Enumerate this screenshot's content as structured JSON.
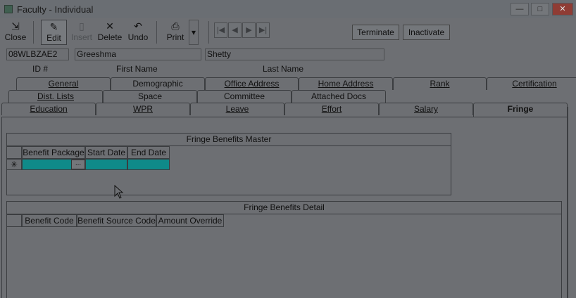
{
  "window": {
    "title": "Faculty - Individual",
    "minimize_symbol": "—",
    "maximize_symbol": "□",
    "close_symbol": "✕"
  },
  "toolbar": {
    "close": "Close",
    "edit": "Edit",
    "insert": "Insert",
    "delete": "Delete",
    "undo": "Undo",
    "print": "Print",
    "print_dropdown": "▾",
    "nav_first": "|◀",
    "nav_prev": "◀",
    "nav_next": "▶",
    "nav_last": "▶|",
    "terminate": "Terminate",
    "inactivate": "Inactivate"
  },
  "record": {
    "id_value": "08WLBZAE2",
    "first_name_value": "Greeshma",
    "last_name_value": "Shetty",
    "id_label": "ID #",
    "first_name_label": "First Name",
    "last_name_label": "Last Name"
  },
  "tabs": {
    "row1": [
      "General",
      "Demographic",
      "Office Address",
      "Home Address",
      "Rank",
      "Certification"
    ],
    "row2": [
      "Dist. Lists",
      "Space",
      "Committee",
      "Attached Docs"
    ],
    "row3": [
      "Education",
      "WPR",
      "Leave",
      "Effort",
      "Salary",
      "Fringe"
    ]
  },
  "master": {
    "title": "Fringe Benefits Master",
    "columns": [
      "Benefit Package",
      "Start Date",
      "End Date"
    ],
    "new_row_marker": "✳",
    "ellipsis": "..."
  },
  "detail": {
    "title": "Fringe Benefits Detail",
    "columns": [
      "Benefit Code",
      "Benefit Source Code",
      "Amount Override"
    ]
  },
  "colors": {
    "selected_row": "#0f8a89",
    "close_button": "#8f3c34"
  }
}
